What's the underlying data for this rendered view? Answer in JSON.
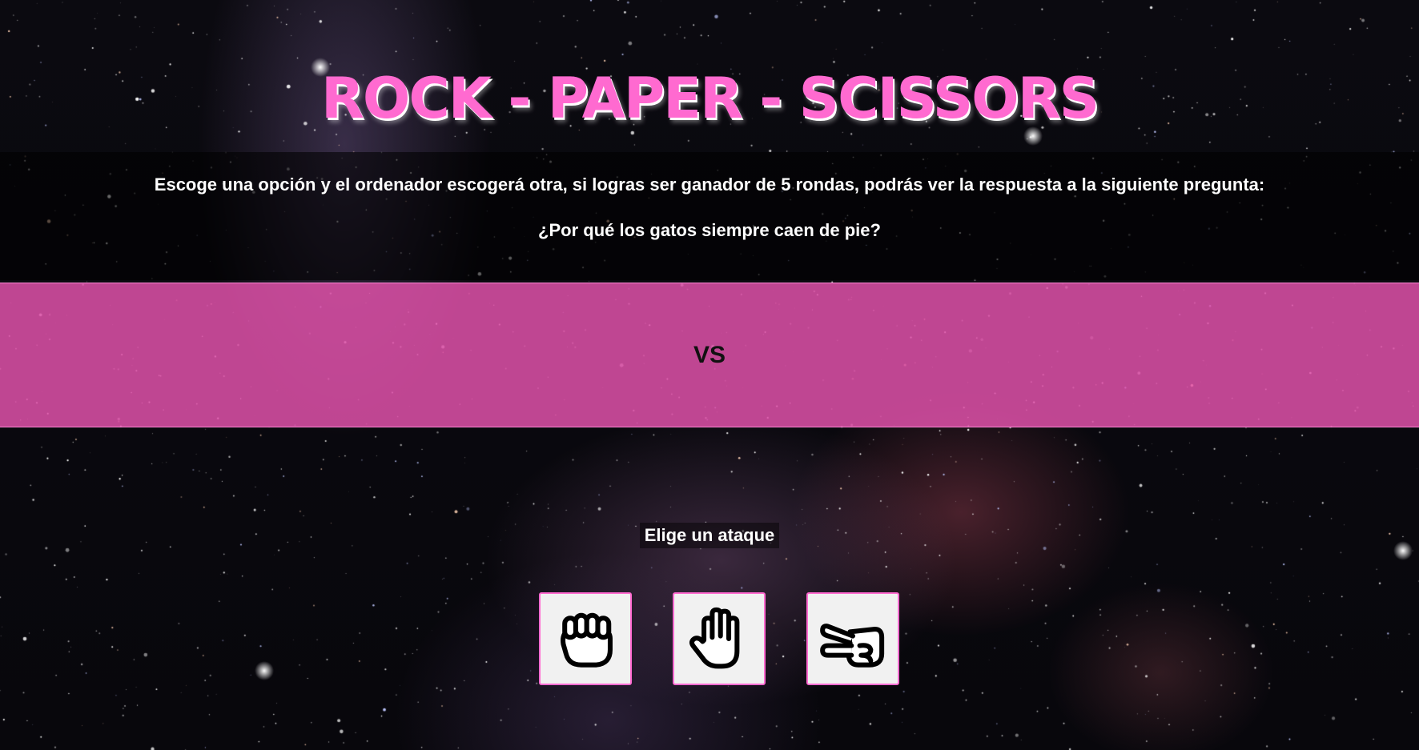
{
  "header": {
    "title": "ROCK - PAPER - SCISSORS"
  },
  "intro": {
    "instructions": "Escoge una opción y el ordenador escogerá otra, si logras ser ganador de 5 rondas, podrás ver la respuesta a la siguiente pregunta:",
    "question": "¿Por qué los gatos siempre caen de pie?"
  },
  "arena": {
    "vs_label": "VS"
  },
  "attacks": {
    "prompt": "Elige un ataque",
    "options": [
      {
        "id": "rock",
        "icon": "rock-fist-icon"
      },
      {
        "id": "paper",
        "icon": "paper-hand-icon"
      },
      {
        "id": "scissors",
        "icon": "scissors-hand-icon"
      }
    ]
  },
  "colors": {
    "accent_pink": "#ff6ad0",
    "band_pink": "#e252ac",
    "button_bg": "#f1f1f1",
    "background": "#07060b"
  }
}
